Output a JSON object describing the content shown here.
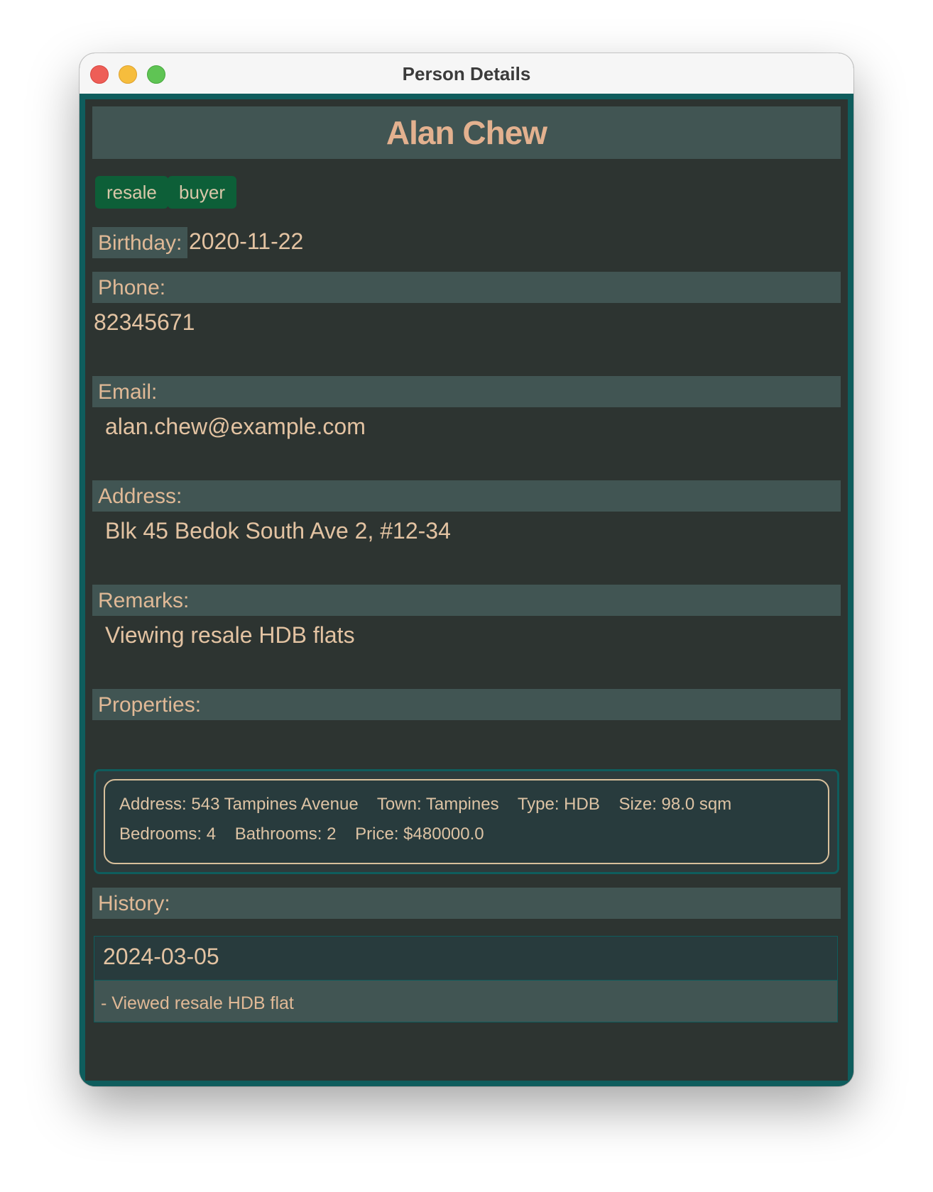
{
  "window": {
    "title": "Person Details"
  },
  "person": {
    "name": "Alan Chew",
    "tags": [
      "resale",
      "buyer"
    ],
    "birthday_label": "Birthday:",
    "birthday": "2020-11-22",
    "phone_label": "Phone:",
    "phone": "82345671",
    "email_label": "Email:",
    "email": "alan.chew@example.com",
    "address_label": "Address:",
    "address": "Blk 45 Bedok South Ave 2, #12-34",
    "remarks_label": "Remarks:",
    "remarks": "Viewing resale HDB flats",
    "properties_label": "Properties:",
    "properties": [
      {
        "address": "Address: 543 Tampines Avenue",
        "town": "Town: Tampines",
        "type": "Type: HDB",
        "size": "Size: 98.0 sqm",
        "bedrooms": "Bedrooms: 4",
        "bathrooms": "Bathrooms: 2",
        "price": "Price: $480000.0"
      }
    ],
    "history_label": "History:",
    "history": [
      {
        "date": "2024-03-05",
        "entry": "- Viewed resale HDB flat"
      }
    ]
  },
  "colors": {
    "background": "#2d3431",
    "label_bg": "#415553",
    "accent_border": "#0f5d5d",
    "name_text": "#e3b18f",
    "tag_bg": "#0d5f38"
  }
}
